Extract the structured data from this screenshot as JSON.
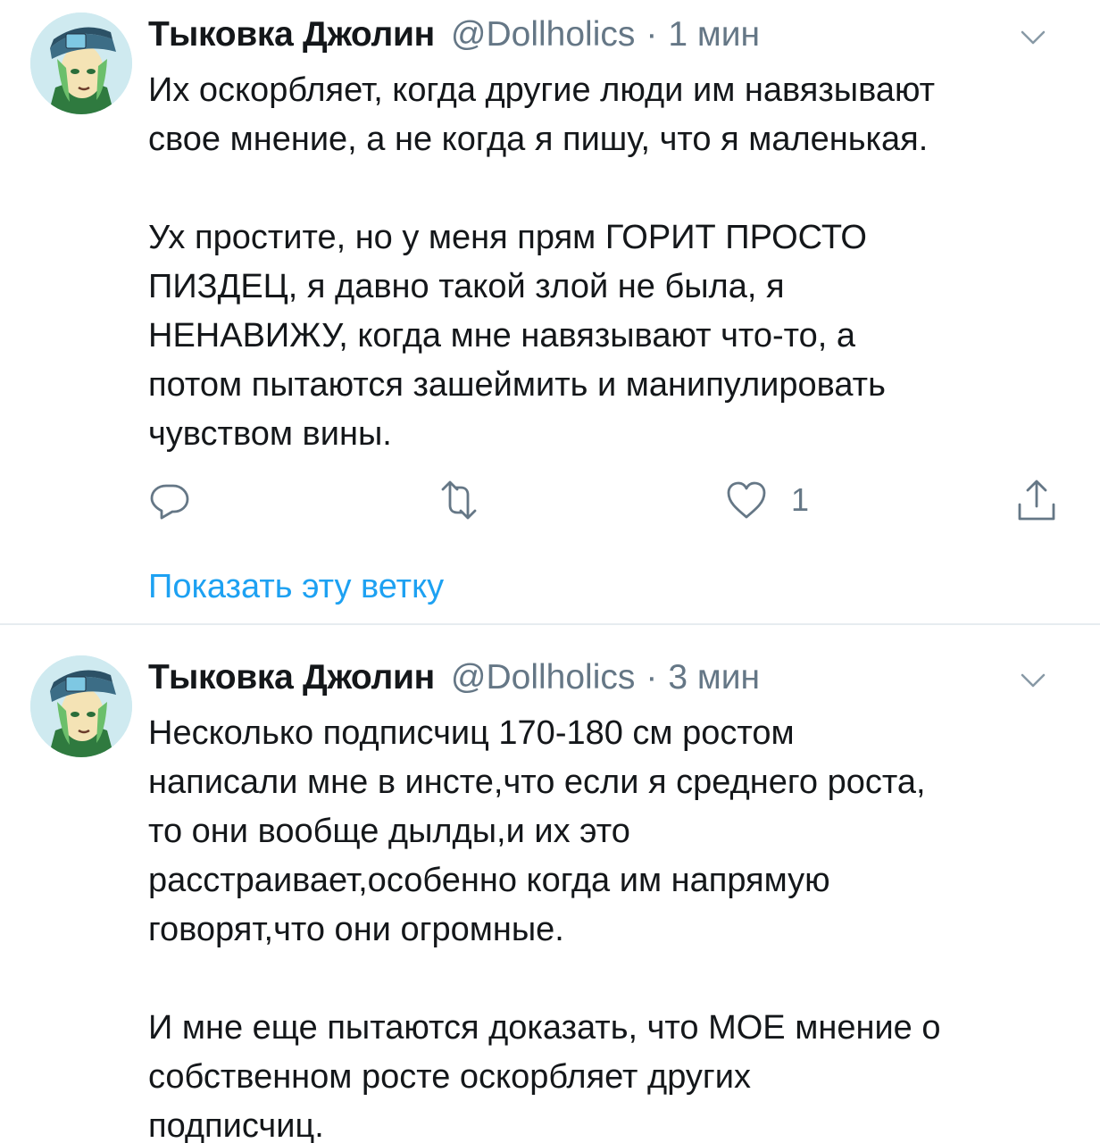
{
  "tweets": [
    {
      "display_name": "Тыковка Джолин",
      "handle": "@Dollholics",
      "separator": "·",
      "time": "1 мин",
      "text": "Их оскорбляет, когда другие люди им навязывают\nсвое мнение, а не когда я пишу, что я маленькая.\n\nУх простите, но у меня прям ГОРИТ ПРОСТО\nПИЗДЕЦ, я давно такой злой не была, я\nНЕНАВИЖУ, когда мне навязывают что-то, а\nпотом пытаются зашеймить и манипулировать\nчувством вины.",
      "like_count": "1",
      "show_thread": "Показать эту ветку"
    },
    {
      "display_name": "Тыковка Джолин",
      "handle": "@Dollholics",
      "separator": "·",
      "time": "3 мин",
      "text": "Несколько подписчиц 170-180 см ростом\nнаписали мне в инсте,что если я среднего роста,\nто они вообще дылды,и их это\nрасстраивает,особенно когда им напрямую\nговорят,что они огромные.\n\nИ мне еще пытаются доказать, что МОЕ мнение о\nсобственном росте оскорбляет других\nподписчиц."
    }
  ],
  "icons": {
    "reply": "reply-icon",
    "retweet": "retweet-icon",
    "like": "like-icon",
    "share": "share-icon",
    "more": "chevron-down-icon"
  },
  "colors": {
    "link": "#1da1f2",
    "secondary_text": "#657786",
    "divider": "#e6ecf0"
  }
}
